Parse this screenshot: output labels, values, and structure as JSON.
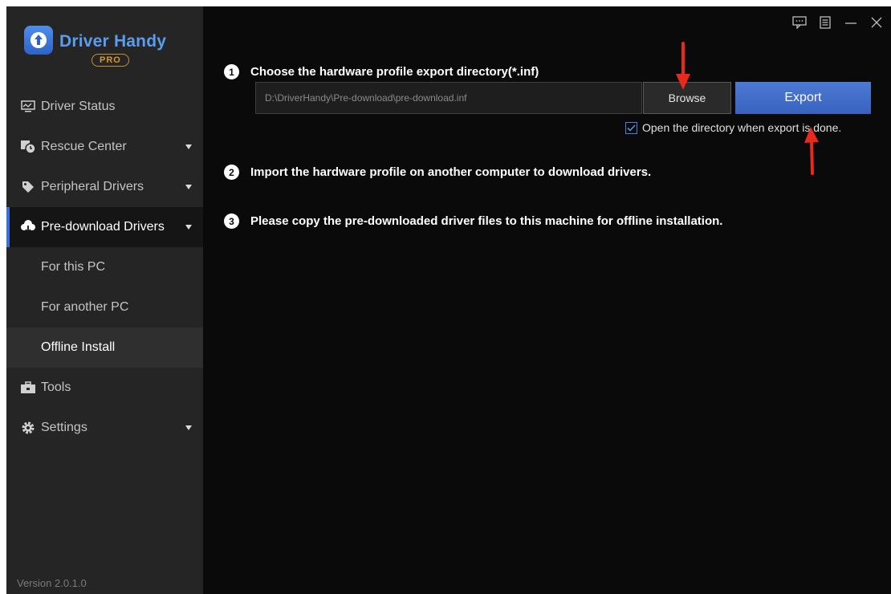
{
  "app": {
    "name": "Driver Handy",
    "badge": "PRO",
    "version": "Version 2.0.1.0"
  },
  "sidebar": {
    "items": [
      {
        "label": "Driver Status",
        "icon": "monitor-icon"
      },
      {
        "label": "Rescue Center",
        "icon": "rescue-icon",
        "has_caret": true
      },
      {
        "label": "Peripheral Drivers",
        "icon": "tag-icon",
        "has_caret": true
      },
      {
        "label": "Pre-download Drivers",
        "icon": "cloud-download-icon",
        "has_caret": true,
        "active": true
      }
    ],
    "sub_items": [
      {
        "label": "For this PC"
      },
      {
        "label": "For another PC"
      },
      {
        "label": "Offline Install",
        "selected": true
      }
    ],
    "bottom_items": [
      {
        "label": "Tools",
        "icon": "toolbox-icon"
      },
      {
        "label": "Settings",
        "icon": "gear-icon",
        "has_caret": true
      }
    ]
  },
  "window_controls": [
    "feedback-icon",
    "menu-icon",
    "minimize-icon",
    "close-icon"
  ],
  "steps": [
    {
      "number": "1",
      "text": "Choose the hardware profile export directory(*.inf)"
    },
    {
      "number": "2",
      "text": "Import the hardware profile on another computer to download drivers."
    },
    {
      "number": "3",
      "text": "Please copy the pre-downloaded driver files to this machine for offline installation."
    }
  ],
  "export": {
    "path_value": "D:\\DriverHandy\\Pre-download\\pre-download.inf",
    "browse_label": "Browse",
    "export_label": "Export",
    "checkbox_label": "Open the directory when export is done.",
    "checkbox_checked": true
  },
  "colors": {
    "accent": "#3a6fd8",
    "export_button": "#4470c8",
    "annotation_arrow": "#e8291c",
    "pro_badge": "#d49a2e"
  }
}
